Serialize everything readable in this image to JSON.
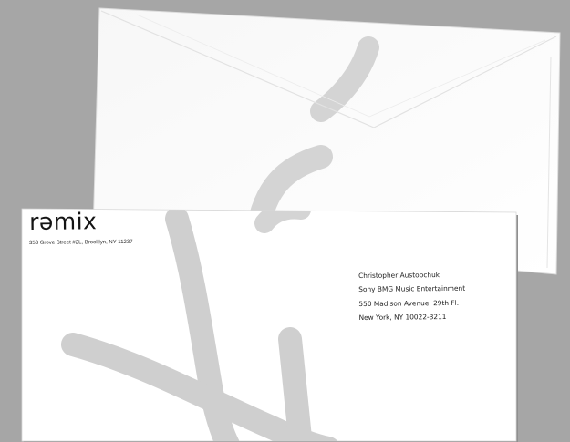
{
  "logo": {
    "wordmark": "rəmix"
  },
  "return_address": {
    "line": "353 Grove Street #2L, Brooklyn, NY 11237"
  },
  "recipient": {
    "lines": [
      "Christopher Austopchuk",
      "Sony BMG Music Entertainment",
      "550 Madison Avenue, 29th Fl.",
      "New York, NY 10022-3211"
    ]
  },
  "colors": {
    "background": "#a6a6a6",
    "paper": "#ffffff",
    "swirl": "#cdcdcd"
  }
}
